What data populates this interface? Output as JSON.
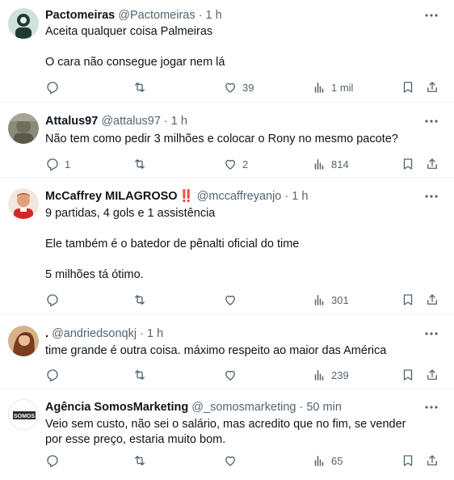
{
  "tweets": [
    {
      "name": "Pactomeiras",
      "badge": "",
      "handle": "@Pactomeiras",
      "dot": "·",
      "time": "1 h",
      "lines": [
        "Aceita qualquer coisa Palmeiras",
        "O cara não consegue jogar nem lá"
      ],
      "counts": {
        "reply": "",
        "retweet": "",
        "like": "39",
        "views": "1 mil"
      }
    },
    {
      "name": "Attalus97",
      "badge": "",
      "handle": "@attalus97",
      "dot": "·",
      "time": "1 h",
      "lines": [
        "Não tem como pedir 3 milhões e colocar o Rony no mesmo pacote?"
      ],
      "counts": {
        "reply": "1",
        "retweet": "",
        "like": "2",
        "views": "814"
      }
    },
    {
      "name": "McCaffrey MILAGROSO",
      "badge": "‼️",
      "handle": "@mccaffreyanjo",
      "dot": "·",
      "time": "1 h",
      "lines": [
        "9 partidas, 4 gols e 1 assistência",
        "Ele também é o batedor de pênalti oficial do time",
        "5 milhões tá ótimo."
      ],
      "counts": {
        "reply": "",
        "retweet": "",
        "like": "",
        "views": "301"
      }
    },
    {
      "name": ".",
      "badge": "",
      "handle": "@andriedsonqkj",
      "dot": "·",
      "time": "1 h",
      "lines": [
        "time grande é outra coisa. máximo respeito ao maior das América"
      ],
      "counts": {
        "reply": "",
        "retweet": "",
        "like": "",
        "views": "239"
      }
    },
    {
      "name": "Agência SomosMarketing",
      "badge": "",
      "handle": "@_somosmarketing",
      "dot": "·",
      "time": "50 min",
      "lines": [
        "Veio sem custo, não sei o salário, mas acredito que no fim, se vender por esse preço, estaria muito bom."
      ],
      "counts": {
        "reply": "",
        "retweet": "",
        "like": "",
        "views": "65"
      }
    }
  ],
  "avatars": {
    "somos_text": "SOMOS"
  },
  "colors": {
    "text": "#0f1419",
    "muted": "#536471",
    "divider": "#eff3f4"
  },
  "icons": [
    "reply-icon",
    "retweet-icon",
    "like-icon",
    "views-icon",
    "bookmark-icon",
    "share-icon",
    "more-icon"
  ]
}
